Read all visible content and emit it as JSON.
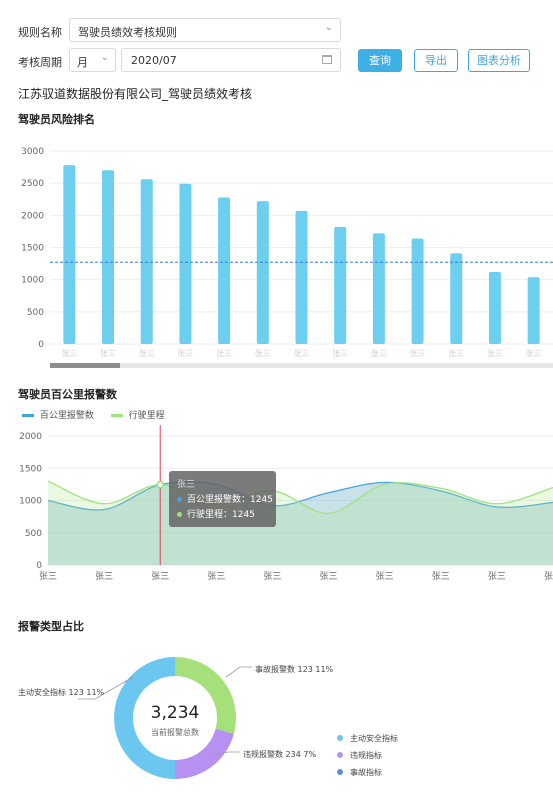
{
  "form": {
    "rule_label": "规则名称",
    "rule_value": "驾驶员绩效考核规则",
    "period_label": "考核周期",
    "period_unit": "月",
    "period_date": "2020/07",
    "query_label": "查询",
    "export_label": "导出",
    "analysis_label": "图表分析"
  },
  "report_title": "江苏驭道数据股份有限公司_驾驶员绩效考核",
  "colors": {
    "bar": "#6ccfef",
    "accent": "#3fb0e6",
    "line1": "#4aa3df",
    "line2": "#9ee37d",
    "pie_main": "#6cc7f0",
    "pie_violation": "#b691f2",
    "pie_accident": "#a6e07a",
    "legend_accident": "#5a8de0"
  },
  "chart_data": [
    {
      "type": "bar",
      "title": "驾驶员风险排名",
      "ylim": [
        0,
        3000
      ],
      "yticks": [
        "3000",
        "2500",
        "2000",
        "1500",
        "1000",
        "500",
        "0"
      ],
      "categories": [
        "张三",
        "张三",
        "张三",
        "张三",
        "张三",
        "张三",
        "张三",
        "张三",
        "张三",
        "张三",
        "张三",
        "张三",
        "张三"
      ],
      "values": [
        2780,
        2700,
        2560,
        2490,
        2280,
        2220,
        2070,
        1820,
        1720,
        1640,
        1410,
        1120,
        1040
      ],
      "average_line": 1270
    },
    {
      "type": "line",
      "title": "驾驶员百公里报警数",
      "ylim": [
        0,
        2000
      ],
      "yticks": [
        "2000",
        "1500",
        "1000",
        "500",
        "0"
      ],
      "categories": [
        "张三",
        "张三",
        "张三",
        "张三",
        "张三",
        "张三",
        "张三",
        "张三",
        "张三",
        "张三"
      ],
      "series": [
        {
          "name": "百公里报警数",
          "values": [
            1000,
            860,
            1245,
            1250,
            920,
            1120,
            1280,
            1150,
            900,
            970
          ]
        },
        {
          "name": "行驶里程",
          "values": [
            1300,
            950,
            1245,
            940,
            1150,
            800,
            1250,
            1190,
            950,
            1200
          ]
        }
      ],
      "tooltip": {
        "title": "张三",
        "rows": [
          "百公里报警数：1245",
          "行驶里程：1245"
        ]
      }
    },
    {
      "type": "pie",
      "title": "报警类型占比",
      "center_value": "3,234",
      "center_label": "当前报警总数",
      "slices": [
        {
          "name": "主动安全指标",
          "value": 123,
          "percent": "11%",
          "label": "主动安全指标 123  11%"
        },
        {
          "name": "违规指标",
          "value": 234,
          "percent": "7%",
          "label": "违规报警数 234  7%"
        },
        {
          "name": "事故指标",
          "value": 123,
          "percent": "11%",
          "label": "事故报警数 123  11%"
        }
      ],
      "legend": [
        "主动安全指标",
        "违规指标",
        "事故指标"
      ]
    }
  ]
}
